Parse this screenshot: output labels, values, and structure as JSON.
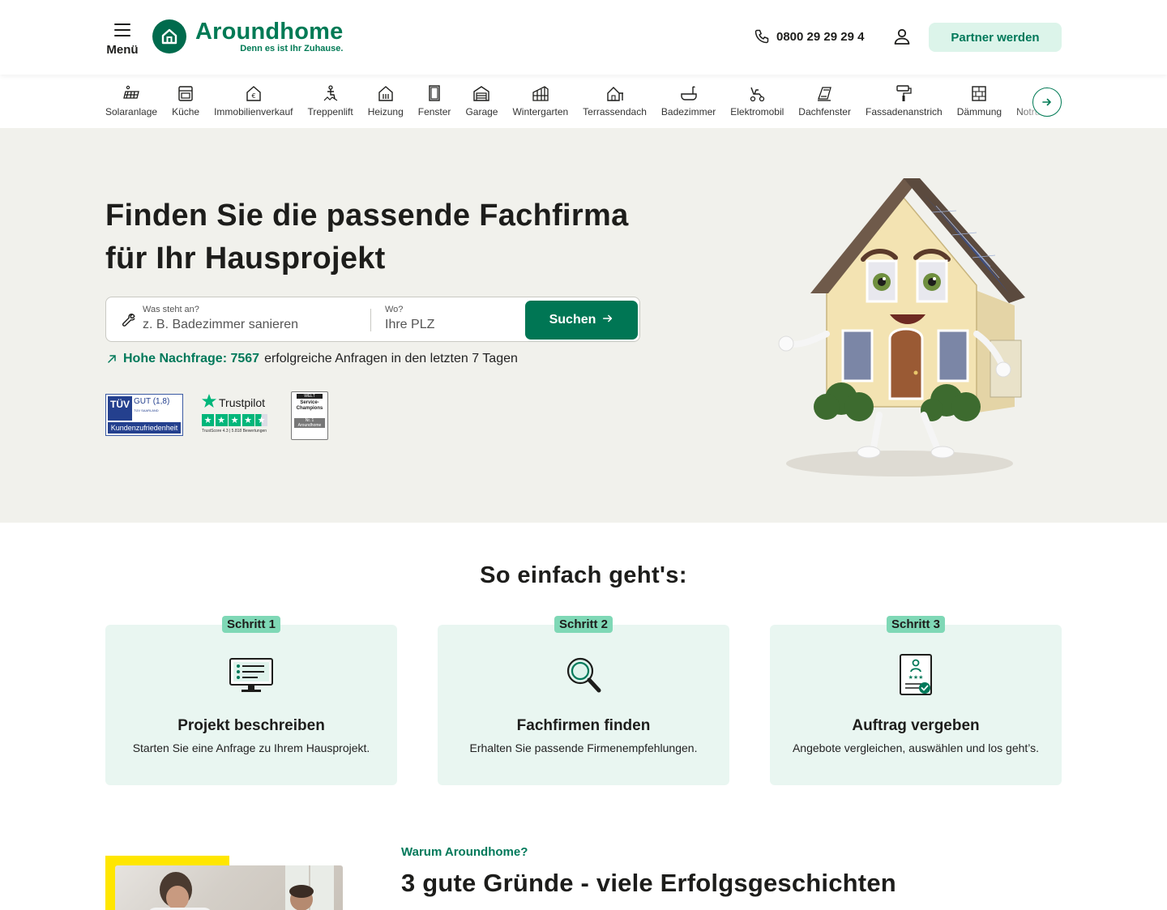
{
  "header": {
    "menu_label": "Menü",
    "logo_name": "Aroundhome",
    "logo_tagline": "Denn es ist Ihr Zuhause.",
    "phone": "0800 29 29 29 4",
    "partner_button": "Partner werden",
    "icons": {
      "menu": "hamburger-icon",
      "logo": "house-icon",
      "phone": "phone-icon",
      "user": "user-icon"
    }
  },
  "categories": [
    {
      "label": "Solaranlage",
      "icon": "solar-panel-icon"
    },
    {
      "label": "Küche",
      "icon": "oven-icon"
    },
    {
      "label": "Immobilienverkauf",
      "icon": "house-euro-icon"
    },
    {
      "label": "Treppenlift",
      "icon": "stairlift-icon"
    },
    {
      "label": "Heizung",
      "icon": "heating-icon"
    },
    {
      "label": "Fenster",
      "icon": "window-icon"
    },
    {
      "label": "Garage",
      "icon": "garage-icon"
    },
    {
      "label": "Wintergarten",
      "icon": "conservatory-icon"
    },
    {
      "label": "Terrassendach",
      "icon": "terrace-roof-icon"
    },
    {
      "label": "Badezimmer",
      "icon": "bathtub-icon"
    },
    {
      "label": "Elektromobil",
      "icon": "mobility-scooter-icon"
    },
    {
      "label": "Dachfenster",
      "icon": "roof-window-icon"
    },
    {
      "label": "Fassadenanstrich",
      "icon": "paint-roller-icon"
    },
    {
      "label": "Dämmung",
      "icon": "insulation-icon"
    },
    {
      "label": "Notrufsysteme",
      "icon": "emergency-icon"
    }
  ],
  "hero": {
    "title_line1": "Finden Sie die passende Fachfirma",
    "title_line2": "für Ihr Hausprojekt",
    "search": {
      "what_label": "Was steht an?",
      "what_placeholder": "z. B. Badezimmer sanieren",
      "where_label": "Wo?",
      "where_placeholder": "Ihre PLZ",
      "button": "Suchen"
    },
    "demand_highlight": "Hohe Nachfrage: 7567",
    "demand_rest": "erfolgreiche Anfragen in den letzten 7 Tagen",
    "badges": {
      "tuv_brand": "TÜV SAARLAND",
      "tuv_grade": "GUT (1,8)",
      "tuv_bar": "Kundenzufriedenheit",
      "trustpilot_name": "Trustpilot",
      "trustpilot_rating": 4.5,
      "trustpilot_score": "TrustScore 4.3 | 5.818 Bewertungen",
      "welt_top": "WELT",
      "welt_title": "Service-Champions",
      "welt_rank": "Nr. 1 Aroundhome"
    }
  },
  "steps": {
    "title": "So einfach geht's:",
    "items": [
      {
        "pill": "Schritt 1",
        "title": "Projekt beschreiben",
        "desc": "Starten Sie eine Anfrage zu Ihrem Hausprojekt.",
        "icon": "monitor-checklist-icon"
      },
      {
        "pill": "Schritt 2",
        "title": "Fachfirmen finden",
        "desc": "Erhalten Sie passende Firmenempfehlungen.",
        "icon": "magnifier-icon"
      },
      {
        "pill": "Schritt 3",
        "title": "Auftrag vergeben",
        "desc": "Angebote vergleichen, auswählen und los geht’s.",
        "icon": "contract-check-icon"
      }
    ]
  },
  "why": {
    "kicker": "Warum Aroundhome?",
    "title": "3 gute Gründe - viele Erfolgsgeschichten"
  },
  "colors": {
    "brand_green": "#007654",
    "accent_light": "#dcf4ea",
    "hero_bg": "#f1f1ec",
    "step_card_bg": "#e9f6f1",
    "pill_green": "#7fd8b6",
    "yellow": "#ffe600"
  }
}
